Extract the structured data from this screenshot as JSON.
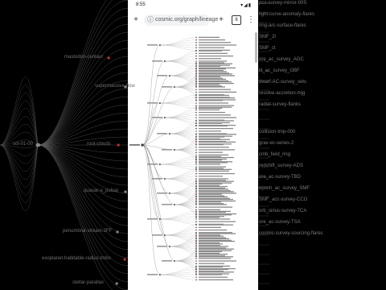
{
  "status": {
    "time": "8:55",
    "icons": "▾◢▮"
  },
  "browser": {
    "url": "cosmic.org/graph/lineage",
    "tab_count": "6",
    "icons": {
      "new_tab": "plus-icon",
      "menu": "more-vert-icon",
      "info": "info-icon",
      "add": "add-bookmark-icon"
    }
  },
  "left_labels": [
    "mastodon-centaur",
    "supermassive-flow",
    "root-clouds",
    "quasar-a_pulsar",
    "penumbral-stream-2FF",
    "exoplanet-habitable-radius-tmbs",
    "stellar-parallax"
  ],
  "root_label": "sol-01-00",
  "right_labels": [
    "pcs-survey-mirror-00S",
    "light-curve-anomaly-flares",
    "ring-arc-surface-flares",
    "SMF_2t",
    "SMF_ct",
    "ore_ac_survey_AGC",
    "lit_ac_survey_GBF",
    "dwarf-AC-survey_sets",
    "resolve-accretion-mjg",
    "radial-survey-flanks",
    "collision-tmp-000",
    "grav-ec-series-2",
    "cmb_field_ring",
    "redshift_survey-ADS",
    "ore_ac-survey-TBD",
    "epoch_ac_survey_SMF",
    "SMF_acc-survey-CCO",
    "orb_sirius-survey-7CA",
    "ore_ac-survey-TSA",
    "cosmic-survey-sourcing-flares"
  ]
}
